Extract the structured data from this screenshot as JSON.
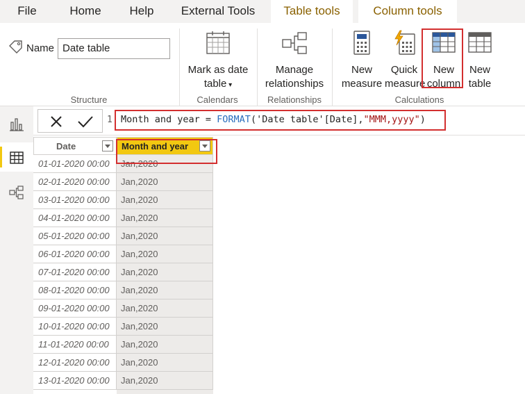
{
  "menu": {
    "file": "File",
    "home": "Home",
    "help": "Help",
    "external_tools": "External Tools",
    "table_tools": "Table tools",
    "column_tools": "Column tools"
  },
  "ribbon": {
    "structure": {
      "name_label": "Name",
      "name_value": "Date table",
      "group_label": "Structure"
    },
    "calendars": {
      "mark_line1": "Mark as date",
      "mark_line2": "table",
      "group_label": "Calendars"
    },
    "relationships": {
      "manage_line1": "Manage",
      "manage_line2": "relationships",
      "group_label": "Relationships"
    },
    "calculations": {
      "new_measure_line1": "New",
      "new_measure_line2": "measure",
      "quick_measure_line1": "Quick",
      "quick_measure_line2": "measure",
      "new_column_line1": "New",
      "new_column_line2": "column",
      "new_table_line1": "New",
      "new_table_line2": "table",
      "group_label": "Calculations"
    }
  },
  "formula_bar": {
    "line_number": "1",
    "formula_prefix": "Month and year = ",
    "formula_function": "FORMAT",
    "formula_args": "('Date table'[Date],",
    "formula_string": "\"MMM,yyyy\"",
    "formula_suffix": ")"
  },
  "grid": {
    "columns": [
      "Date",
      "Month and year"
    ],
    "rows": [
      [
        "01-01-2020 00:00",
        "Jan,2020"
      ],
      [
        "02-01-2020 00:00",
        "Jan,2020"
      ],
      [
        "03-01-2020 00:00",
        "Jan,2020"
      ],
      [
        "04-01-2020 00:00",
        "Jan,2020"
      ],
      [
        "05-01-2020 00:00",
        "Jan,2020"
      ],
      [
        "06-01-2020 00:00",
        "Jan,2020"
      ],
      [
        "07-01-2020 00:00",
        "Jan,2020"
      ],
      [
        "08-01-2020 00:00",
        "Jan,2020"
      ],
      [
        "09-01-2020 00:00",
        "Jan,2020"
      ],
      [
        "10-01-2020 00:00",
        "Jan,2020"
      ],
      [
        "11-01-2020 00:00",
        "Jan,2020"
      ],
      [
        "12-01-2020 00:00",
        "Jan,2020"
      ],
      [
        "13-01-2020 00:00",
        "Jan,2020"
      ]
    ]
  },
  "colors": {
    "accent_yellow": "#f2c811",
    "highlight_red": "#d32f2f",
    "dax_function_blue": "#2a6ebd",
    "dax_string_red": "#a31515"
  }
}
